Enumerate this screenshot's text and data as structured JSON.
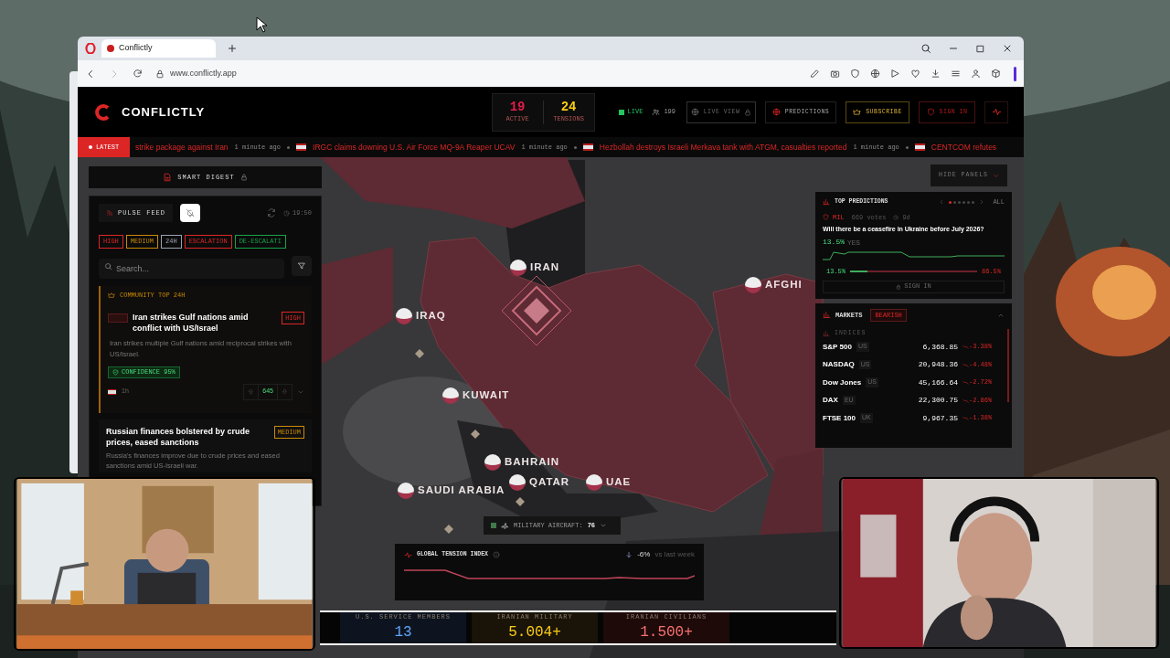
{
  "browser": {
    "tab_title": "Conflictly",
    "url": "www.conflictly.app"
  },
  "header": {
    "brand": "CONFLICTLY",
    "stats": [
      {
        "value": "19",
        "label": "ACTIVE",
        "color": "#e11d48"
      },
      {
        "value": "24",
        "label": "TENSIONS",
        "color": "#facc15"
      }
    ],
    "live": "LIVE",
    "viewers": "199",
    "nav": [
      {
        "kind": "locked",
        "label": "LIVE VIEW"
      },
      {
        "kind": "link",
        "label": "PREDICTIONS"
      },
      {
        "kind": "subscribe",
        "label": "SUBSCRIBE"
      },
      {
        "kind": "signin",
        "label": "SIGN IN"
      }
    ]
  },
  "ticker": {
    "badge": "LATEST",
    "items": [
      {
        "text": "strike package against Iran",
        "time": "1 minute ago"
      },
      {
        "text": "IRGC claims downing U.S. Air Force MQ-9A Reaper UCAV",
        "time": "1 minute ago"
      },
      {
        "text": "Hezbollah destroys Israeli Merkava tank with ATGM, casualties reported",
        "time": "1 minute ago"
      },
      {
        "text": "CENTCOM refutes"
      }
    ]
  },
  "left_panel": {
    "digest": "SMART DIGEST",
    "feed": "PULSE FEED",
    "time": "19:50",
    "filters": [
      {
        "label": "HIGH",
        "color": "#dc2626"
      },
      {
        "label": "MEDIUM",
        "color": "#ca8a04"
      },
      {
        "label": "24H",
        "color": "#9ca3af"
      },
      {
        "label": "ESCALATION",
        "color": "#dc2626"
      },
      {
        "label": "DE-ESCALATI",
        "color": "#16a34a"
      }
    ],
    "search": {
      "placeholder": "Search..."
    },
    "cards": [
      {
        "kind": "top",
        "banner": "COMMUNITY TOP 24H",
        "title": "Iran strikes Gulf nations amid conflict with US/Israel",
        "severity": "HIGH",
        "color": "#dc2626",
        "summary": "Iran strikes multiple Gulf nations amid reciprocal strikes with US/Israel.",
        "confidence": "CONFIDENCE 95%",
        "age": "1h",
        "votes": "645"
      },
      {
        "kind": "plain",
        "title": "Russian finances bolstered by crude prices, eased sanctions",
        "severity": "MEDIUM",
        "color": "#ca8a04",
        "summary": "Russia's finances improve due to crude prices and eased sanctions amid US-Israeli war."
      }
    ]
  },
  "map": {
    "countries": [
      {
        "name": "IRAN"
      },
      {
        "name": "IRAQ"
      },
      {
        "name": "AFGHI"
      },
      {
        "name": "KUWAIT"
      },
      {
        "name": "BAHRAIN"
      },
      {
        "name": "QATAR"
      },
      {
        "name": "UAE"
      },
      {
        "name": "SAUDI ARABIA"
      }
    ],
    "aircraft": {
      "label": "MILITARY AIRCRAFT:",
      "value": "76"
    },
    "tension": {
      "title": "GLOBAL TENSION INDEX",
      "change": "-6%",
      "note": "vs last week"
    }
  },
  "casualties": [
    {
      "label": "U.S. SERVICE MEMBERS",
      "value": "13",
      "color": "#60a5fa"
    },
    {
      "label": "IRANIAN MILITARY",
      "value": "5.004+",
      "color": "#facc15"
    },
    {
      "label": "IRANIAN CIVILIANS",
      "value": "1.500+",
      "color": "#f87171"
    }
  ],
  "right_panel": {
    "hide": "HIDE PANELS",
    "predictions": {
      "title": "TOP PREDICTIONS",
      "all": "ALL",
      "pages": [
        {
          "selected": true
        },
        {
          "selected": false
        },
        {
          "selected": false
        },
        {
          "selected": false
        },
        {
          "selected": false
        },
        {
          "selected": false
        }
      ],
      "category": "MIL",
      "votes": "669 votes",
      "age": "9d",
      "question": "Will there be a ceasefire in Ukraine before July 2026?",
      "yes": "13.5%",
      "yes_label": "YES",
      "level": 0.135,
      "low": "13.5%",
      "high": "86.5%",
      "sign_in": "SIGN IN"
    },
    "markets": {
      "title": "MARKETS",
      "mood": "BEARISH",
      "group": "INDICES",
      "rows": [
        {
          "name": "S&P 500",
          "region": "US",
          "value": "6,368.85",
          "change": "-3.38%"
        },
        {
          "name": "NASDAQ",
          "region": "US",
          "value": "20,948.36",
          "change": "-4.48%"
        },
        {
          "name": "Dow Jones",
          "region": "US",
          "value": "45,166.64",
          "change": "-2.72%"
        },
        {
          "name": "DAX",
          "region": "EU",
          "value": "22,300.75",
          "change": "-2.86%"
        },
        {
          "name": "FTSE 100",
          "region": "UK",
          "value": "9,967.35",
          "change": "-1.38%"
        }
      ]
    }
  }
}
